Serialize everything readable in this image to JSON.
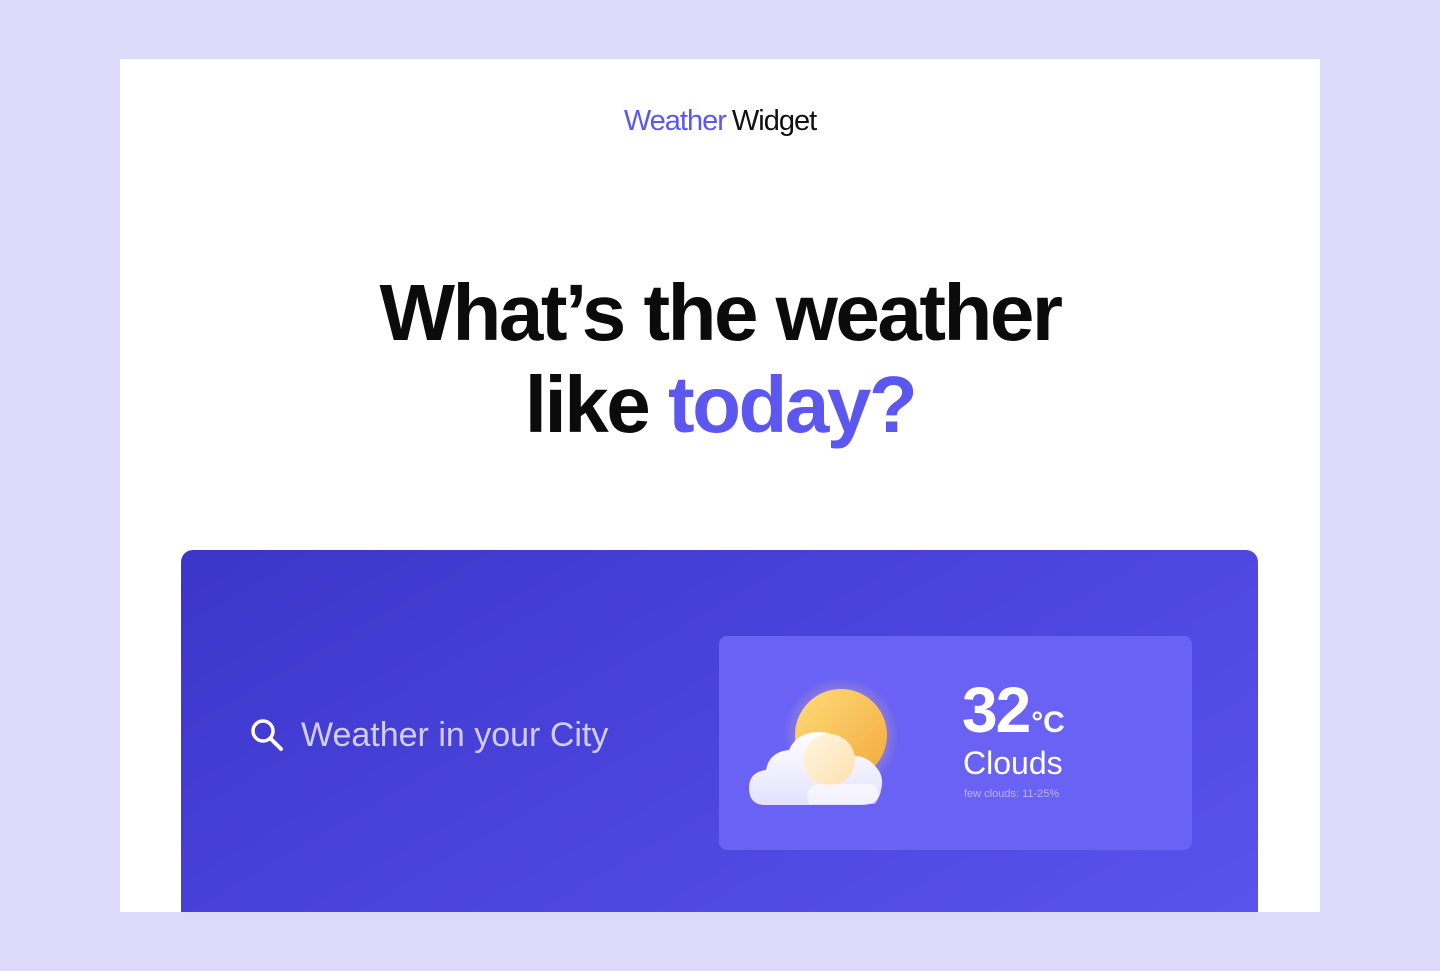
{
  "brand": {
    "accent_word": "Weather",
    "word": "Widget"
  },
  "headline": {
    "line1": "What’s the weather",
    "line2_plain": "like",
    "line2_accent": "today?"
  },
  "search": {
    "icon": "search-icon",
    "placeholder": "Weather in your City",
    "value": ""
  },
  "weather": {
    "icon": "sun-behind-cloud-icon",
    "temperature": "32",
    "unit": "°C",
    "condition": "Clouds",
    "description": "few clouds: 11-25%"
  },
  "colors": {
    "accent": "#5b57f0",
    "page_background": "#dcd9fb",
    "hero_start": "#3c35c9",
    "hero_end": "#5a53ec",
    "card": "#6a62f4"
  }
}
